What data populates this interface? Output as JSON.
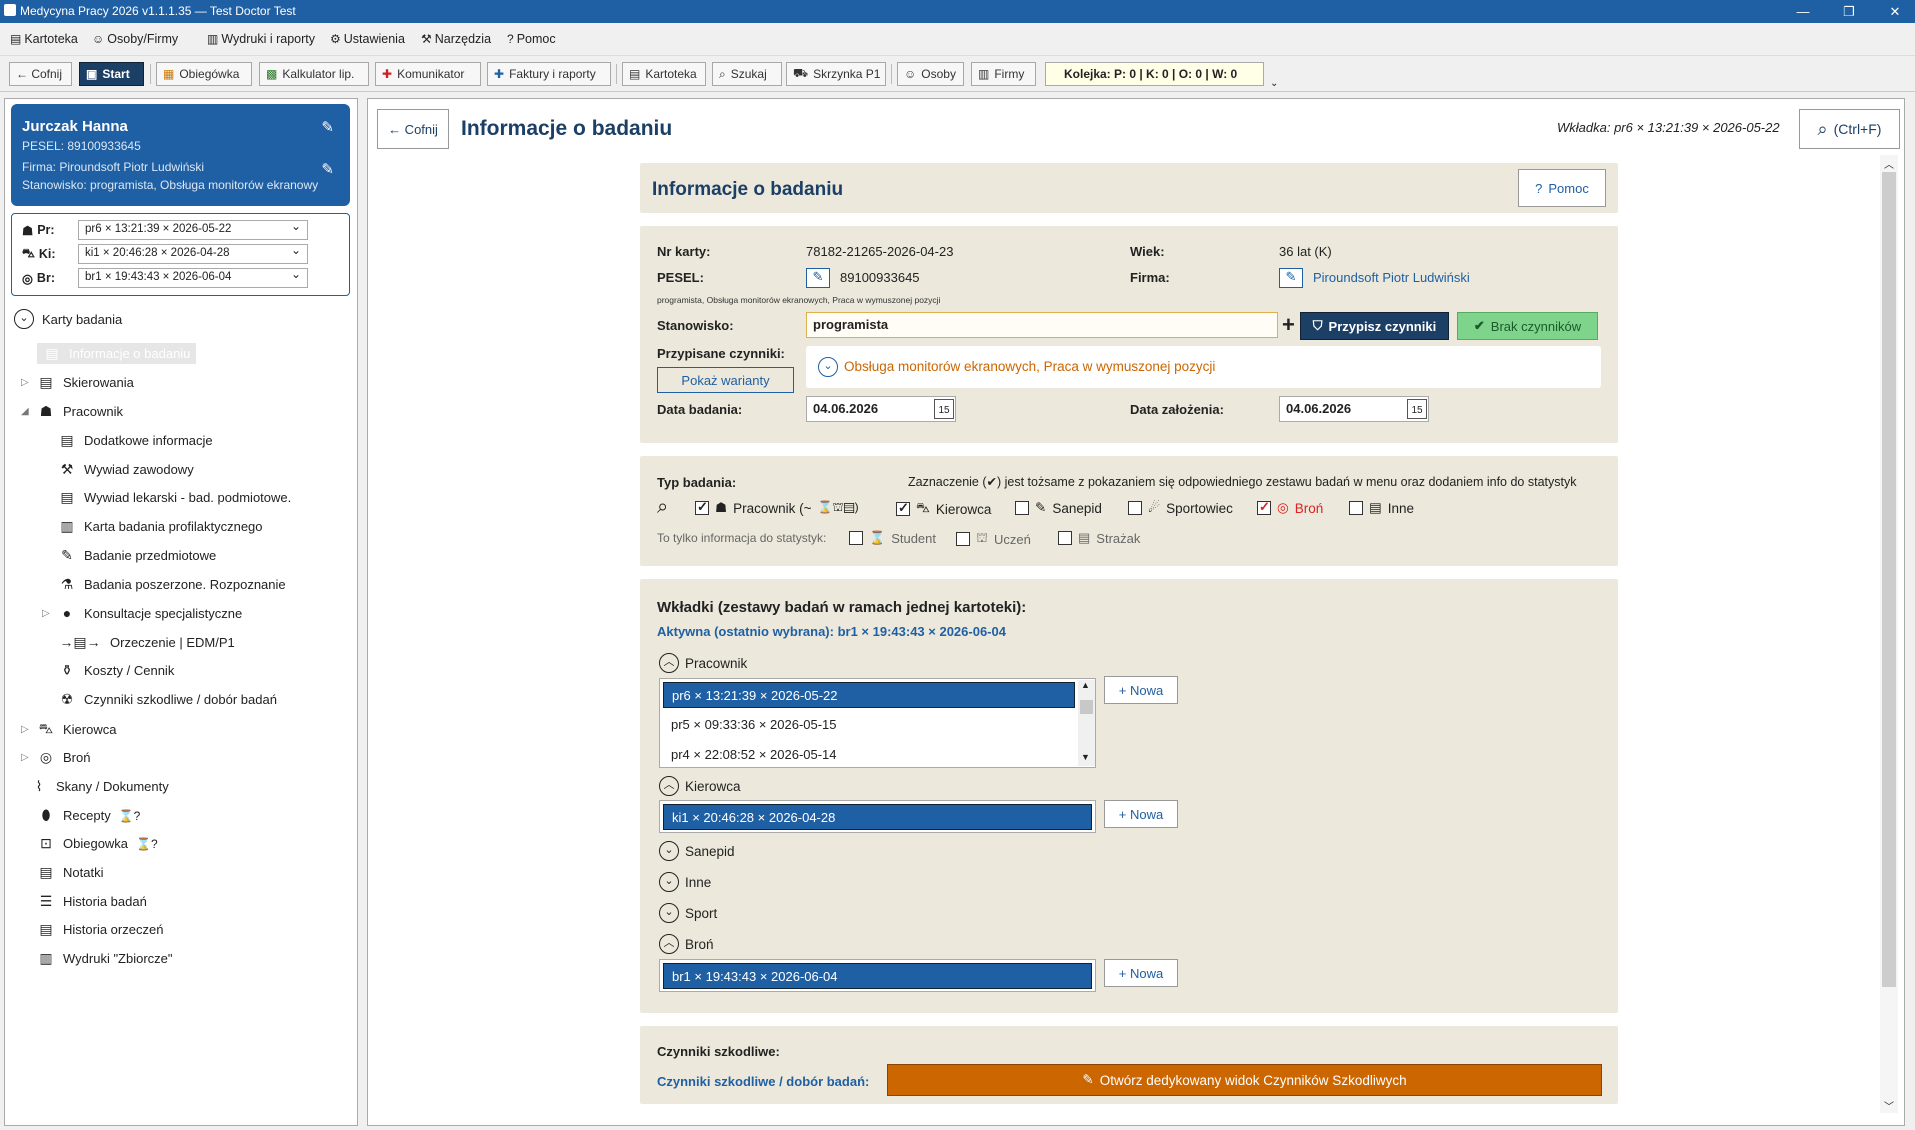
{
  "window": {
    "title": "Medycyna Pracy 2026 v1.1.1.35 — Test Doctor Test"
  },
  "menu": [
    {
      "label": "Kartoteka",
      "icon": "file-icon"
    },
    {
      "label": "Osoby/Firmy",
      "icon": "people-icon"
    },
    {
      "label": "Wydruki i raporty",
      "icon": "print-icon"
    },
    {
      "label": "Ustawienia",
      "icon": "gear-icon"
    },
    {
      "label": "Narzędzia",
      "icon": "tools-icon"
    },
    {
      "label": "Pomoc",
      "icon": "help-icon"
    }
  ],
  "toolbar": {
    "back": "← Cofnij",
    "start": "Start",
    "obiegowka": "Obiegówka",
    "kalkulator": "Kalkulator lip.",
    "komunikator": "Komunikator",
    "faktury": "Faktury i raporty",
    "kartoteka": "Kartoteka",
    "szukaj": "Szukaj",
    "skrzynka": "Skrzynka P1",
    "osoby": "Osoby",
    "firmy": "Firmy",
    "kolejka": "Kolejka: P: 0 | K: 0 | O: 0 | W: 0"
  },
  "patient": {
    "name": "Jurczak   Hanna",
    "pesel": "PESEL:  89100933645",
    "firma": "Firma:  Piroundsoft  Piotr Ludwiński",
    "stanowisko": "Stanowisko:  programista, Obsługa monitorów ekranowy"
  },
  "selectors": [
    {
      "label": "Pr:",
      "value": "pr6 × 13:21:39 × 2026-05-22",
      "icon": "worker-icon"
    },
    {
      "label": "Ki:",
      "value": "ki1 × 20:46:28 × 2026-04-28",
      "icon": "car-icon"
    },
    {
      "label": "Br:",
      "value": "br1 × 19:43:43 × 2026-06-04",
      "icon": "target-icon"
    }
  ],
  "tree": {
    "root": "Karty badania",
    "selected": "Informacje o badaniu",
    "skierowania": "Skierowania",
    "pracownik": "Pracownik",
    "children": [
      "Dodatkowe informacje",
      "Wywiad zawodowy",
      "Wywiad lekarski - bad. podmiotowe.",
      "Karta badania profilaktycznego",
      "Badanie przedmiotowe",
      "Badania poszerzone. Rozpoznanie",
      "Konsultacje specjalistyczne",
      "Orzeczenie | EDM/P1",
      "Koszty / Cennik",
      "Czynniki szkodliwe / dobór badań"
    ],
    "kierowca": "Kierowca",
    "bron": "Broń",
    "others": [
      "Skany / Dokumenty",
      "Recepty",
      "Obiegowka",
      "Notatki",
      "Historia badań",
      "Historia orzeczeń",
      "Wydruki \"Zbiorcze\""
    ]
  },
  "header": {
    "back": "← Cofnij",
    "title": "Informacje o badaniu",
    "tab_info": "Wkładka: pr6 × 13:21:39 × 2026-05-22",
    "search": "(Ctrl+F)"
  },
  "panel": {
    "title": "Informacje o badaniu",
    "help": "Pomoc"
  },
  "info": {
    "nr_karty_label": "Nr karty:",
    "nr_karty": "78182-21265-2026-04-23",
    "wiek_label": "Wiek:",
    "wiek": "36 lat (K)",
    "pesel_label": "PESEL:",
    "pesel": "89100933645",
    "firma_label": "Firma:",
    "firma": "Piroundsoft  Piotr Ludwiński",
    "stanowisko_small": "programista, Obsługa monitorów ekranowych, Praca w wymuszonej pozycji",
    "stanowisko_label": "Stanowisko:",
    "stanowisko": "programista",
    "przypisz": "Przypisz czynniki",
    "brak": "Brak czynników",
    "czynniki_label": "Przypisane czynniki:",
    "pokaz": "Pokaż warianty",
    "czynniki": "Obsługa monitorów ekranowych, Praca w wymuszonej pozycji",
    "data_badania_label": "Data badania:",
    "data_badania": "04.06.2026",
    "data_zal_label": "Data założenia:",
    "data_zal": "04.06.2026",
    "calendar_day": "15"
  },
  "typ": {
    "label": "Typ badania:",
    "note": "Zaznaczenie (✔) jest tożsame z pokazaniem się odpowiedniego zestawu badań w menu oraz dodaniem info do statystyk",
    "options": [
      {
        "label": "Pracownik (~",
        "checked": true
      },
      {
        "label": "Kierowca",
        "checked": true
      },
      {
        "label": "Sanepid",
        "checked": false
      },
      {
        "label": "Sportowiec",
        "checked": false
      },
      {
        "label": "Broń",
        "checked": true
      },
      {
        "label": "Inne",
        "checked": false
      }
    ],
    "stat_label": "To tylko informacja do statystyk:",
    "stat_options": [
      {
        "label": "Student",
        "checked": false
      },
      {
        "label": "Uczeń",
        "checked": false
      },
      {
        "label": "Strażak",
        "checked": false
      }
    ]
  },
  "wkladki": {
    "title": "Wkładki (zestawy badań w ramach jednej kartoteki):",
    "active": "Aktywna (ostatnio wybrana):  br1 × 19:43:43 × 2026-06-04",
    "nowa": "+ Nowa",
    "sections": {
      "pracownik": "Pracownik",
      "kierowca": "Kierowca",
      "sanepid": "Sanepid",
      "inne": "Inne",
      "sport": "Sport",
      "bron": "Broń"
    },
    "pracownik_items": [
      "pr6 × 13:21:39 × 2026-05-22",
      "pr5 × 09:33:36 × 2026-05-15",
      "pr4 × 22:08:52 × 2026-05-14"
    ],
    "kierowca_items": [
      "ki1 × 20:46:28 × 2026-04-28"
    ],
    "bron_items": [
      "br1 × 19:43:43 × 2026-06-04"
    ]
  },
  "czynniki": {
    "title": "Czynniki szkodliwe:",
    "link": "Czynniki szkodliwe / dobór badań:",
    "button": "Otwórz dedykowany widok Czynników Szkodliwych"
  },
  "colors": {
    "primary": "#1f5fa3",
    "accent_orange": "#cc6600",
    "success_green": "#7ed48a",
    "panel_bg": "#ece9dc"
  }
}
